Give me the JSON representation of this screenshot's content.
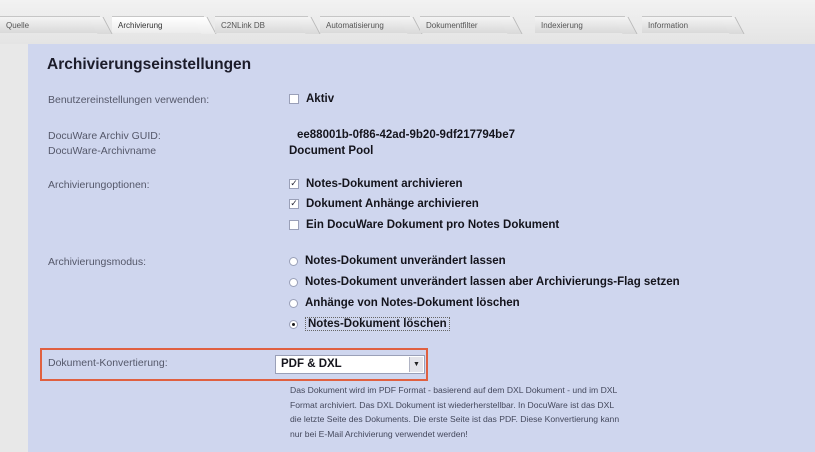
{
  "tabs": [
    {
      "label": "Quelle"
    },
    {
      "label": "Archivierung"
    },
    {
      "label": "C2NLink DB"
    },
    {
      "label": "Automatisierung"
    },
    {
      "label": "Dokumentfilter"
    },
    {
      "label": "Indexierung"
    },
    {
      "label": "Information"
    }
  ],
  "active_tab": "Archivierung",
  "title": "Archivierungseinstellungen",
  "user_settings": {
    "label": "Benutzereinstellungen verwenden:",
    "option": "Aktiv",
    "checked": false
  },
  "guid": {
    "label": "DocuWare Archiv GUID:",
    "value": "ee88001b-0f86-42ad-9b20-9df217794be7"
  },
  "archive_name": {
    "label": "DocuWare-Archivname",
    "value": "Document Pool"
  },
  "archive_options": {
    "label": "Archivierungoptionen:",
    "items": [
      {
        "label": "Notes-Dokument archivieren",
        "checked": true
      },
      {
        "label": "Dokument Anhänge archivieren",
        "checked": true
      },
      {
        "label": "Ein DocuWare Dokument pro Notes Dokument",
        "checked": false
      }
    ]
  },
  "archive_mode": {
    "label": "Archivierungsmodus:",
    "items": [
      {
        "label": "Notes-Dokument unverändert lassen",
        "selected": false
      },
      {
        "label": "Notes-Dokument unverändert lassen aber Archivierungs-Flag setzen",
        "selected": false
      },
      {
        "label": "Anhänge von Notes-Dokument löschen",
        "selected": false
      },
      {
        "label": "Notes-Dokument löschen",
        "selected": true
      }
    ]
  },
  "conversion": {
    "label": "Dokument-Konvertierung:",
    "value": "PDF & DXL",
    "description": [
      "Das Dokument wird im PDF Format - basierend auf dem DXL Dokument - und im DXL",
      "Format archiviert. Das DXL Dokument ist wiederherstellbar. In DocuWare ist das DXL",
      "die letzte Seite des Dokuments. Die erste Seite ist das PDF. Diese Konvertierung kann",
      "nur bei E-Mail Archivierung verwendet werden!"
    ]
  },
  "colors": {
    "panel": "#cfd6ee",
    "highlight": "#e06040"
  }
}
